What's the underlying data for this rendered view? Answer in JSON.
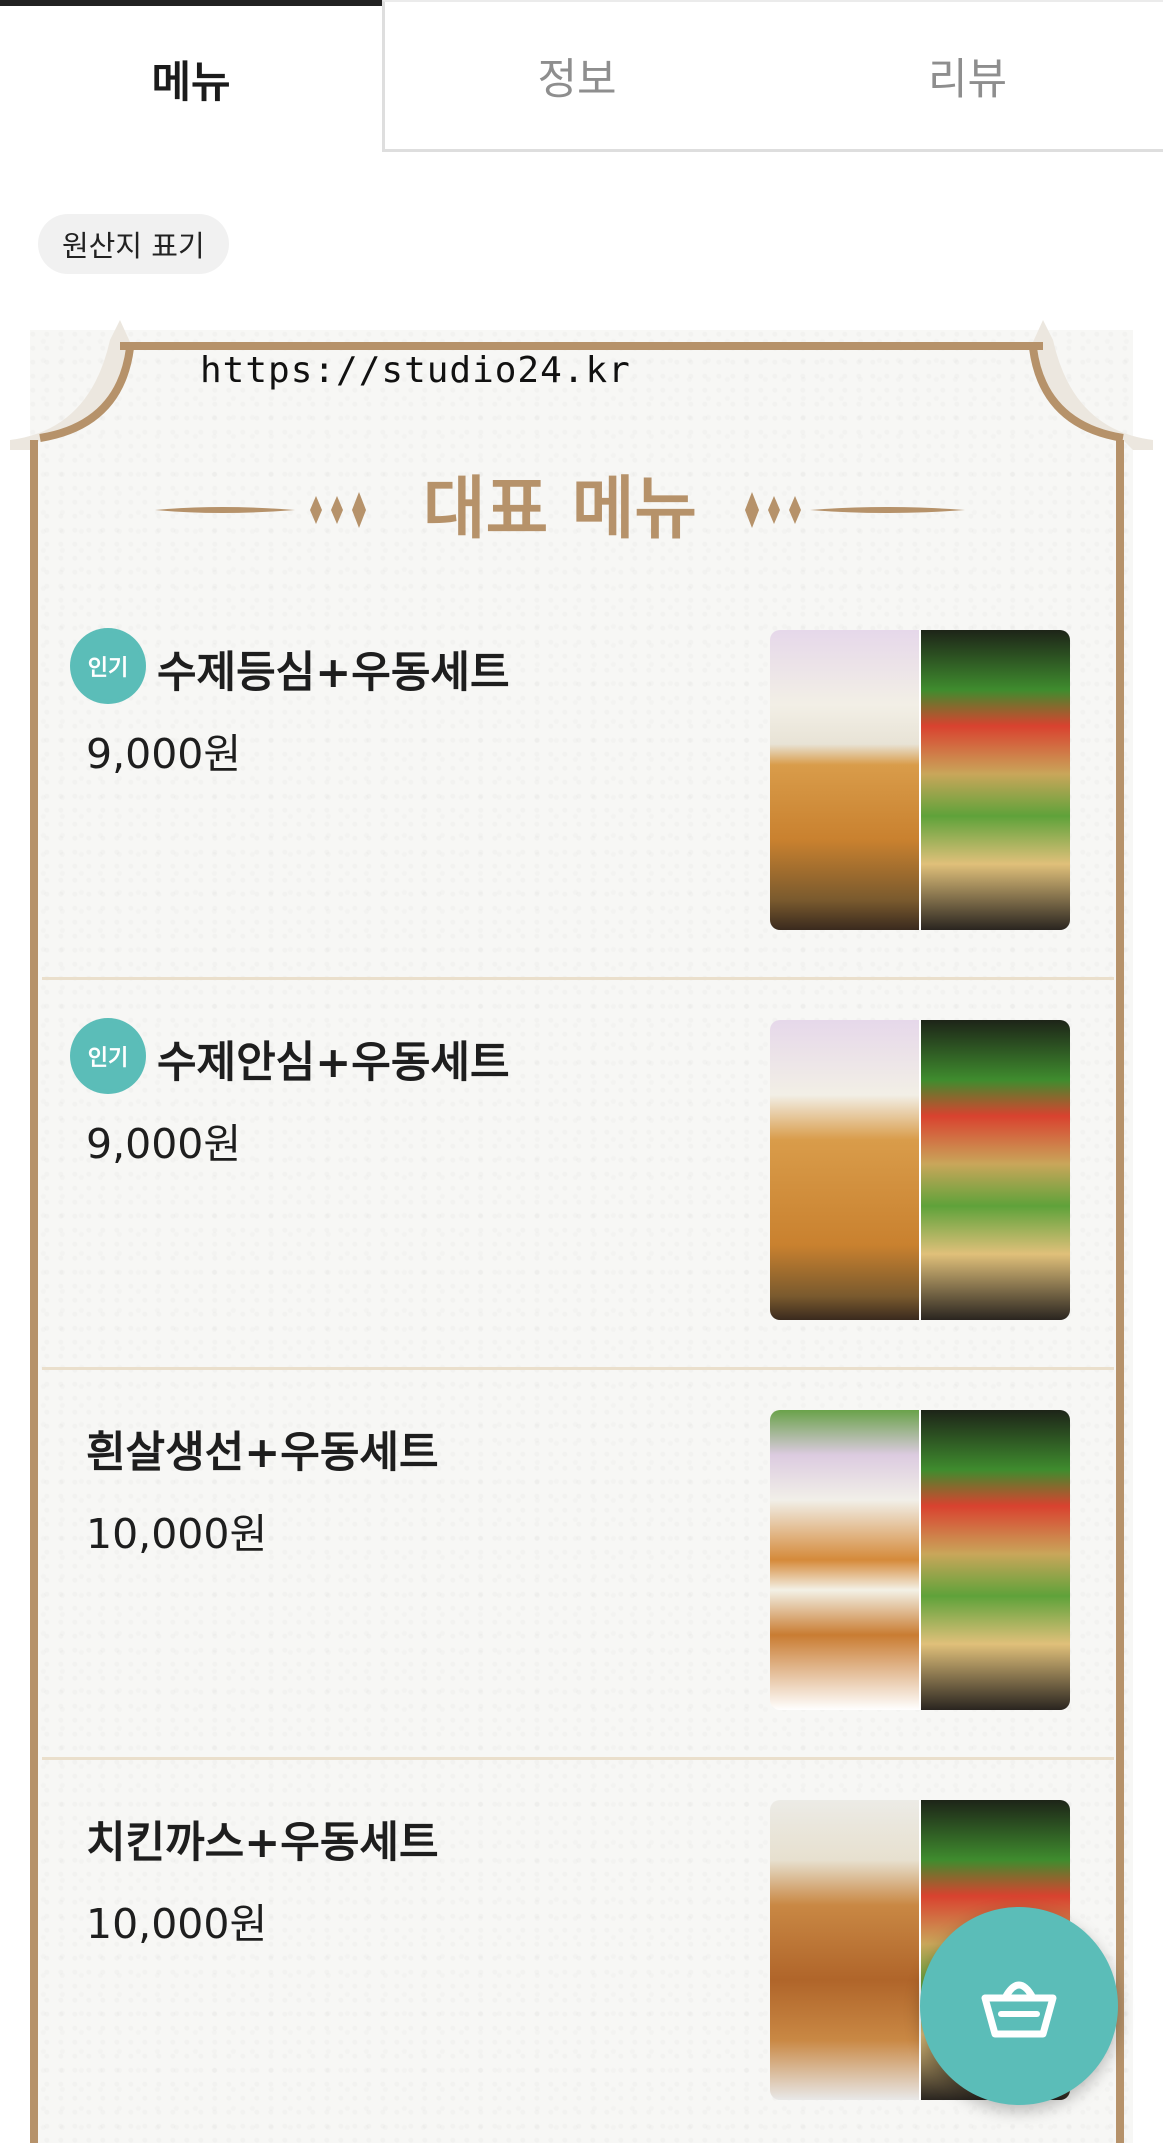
{
  "tabs": [
    {
      "label": "메뉴",
      "active": true
    },
    {
      "label": "정보",
      "active": false
    },
    {
      "label": "리뷰",
      "active": false
    }
  ],
  "origin_chip": "원산지 표기",
  "url_overlay": "https://studio24.kr",
  "section_title": "대표 메뉴",
  "items": [
    {
      "badge": "인기",
      "name": "수제등심+우동세트",
      "price": "9,000원"
    },
    {
      "badge": "인기",
      "name": "수제안심+우동세트",
      "price": "9,000원"
    },
    {
      "badge": "",
      "name": "흰살생선+우동세트",
      "price": "10,000원"
    },
    {
      "badge": "",
      "name": "치킨까스+우동세트",
      "price": "10,000원"
    }
  ],
  "colors": {
    "accent": "#b6926a",
    "badge": "#5bbdb8",
    "fab": "#5bbdb8"
  },
  "icons": {
    "cart": "basket-icon"
  }
}
